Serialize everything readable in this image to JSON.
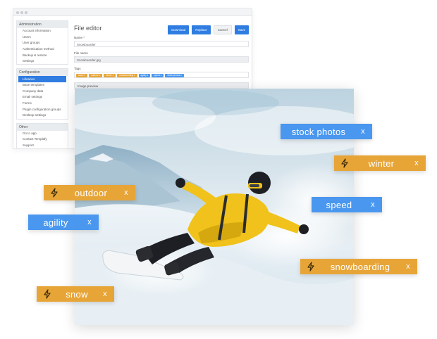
{
  "sidebar": {
    "groups": [
      {
        "title": "Administration",
        "items": [
          "Account information",
          "Users",
          "User groups",
          "Authentication method",
          "Backup & restore",
          "Settings"
        ]
      },
      {
        "title": "Configuration",
        "items": [
          "Libraries",
          "Base templates",
          "Company data",
          "Email settings",
          "Forms",
          "Plugin configuration groups",
          "Desktop settings"
        ],
        "active_index": 0
      },
      {
        "title": "Other",
        "items": [
          "Go to app",
          "Contact Templafy",
          "Support"
        ]
      }
    ]
  },
  "editor": {
    "title": "File editor",
    "buttons": {
      "download": "Download",
      "replace": "Replace",
      "cancel": "Cancel",
      "save": "Save"
    },
    "name_label": "Name *",
    "name_value": "Snowboarder",
    "filename_label": "File name",
    "filename_value": "Snowboarder.jpg",
    "tags_label": "Tags",
    "mini_tags": [
      {
        "label": "snow x",
        "color": "orange"
      },
      {
        "label": "outdoor x",
        "color": "orange"
      },
      {
        "label": "winter x",
        "color": "orange"
      },
      {
        "label": "snowboarding x",
        "color": "orange"
      },
      {
        "label": "agility x",
        "color": "blue"
      },
      {
        "label": "speed x",
        "color": "blue"
      },
      {
        "label": "stock photos x",
        "color": "blue"
      }
    ],
    "preview_label": "Image preview"
  },
  "overlay_tags": {
    "stock_photos": {
      "label": "stock photos",
      "remove": "x",
      "color": "#4a97ef"
    },
    "winter": {
      "label": "winter",
      "remove": "x",
      "color": "#e7a538",
      "icon": "lightning-icon"
    },
    "outdoor": {
      "label": "outdoor",
      "remove": "x",
      "color": "#e7a538",
      "icon": "lightning-icon"
    },
    "speed": {
      "label": "speed",
      "remove": "x",
      "color": "#4a97ef"
    },
    "agility": {
      "label": "agility",
      "remove": "x",
      "color": "#4a97ef"
    },
    "snowboarding": {
      "label": "snowboarding",
      "remove": "x",
      "color": "#e7a538",
      "icon": "lightning-icon"
    },
    "snow": {
      "label": "snow",
      "remove": "x",
      "color": "#e7a538",
      "icon": "lightning-icon"
    }
  },
  "colors": {
    "accent_blue": "#2f7de1",
    "tag_blue": "#4a97ef",
    "tag_orange": "#e7a538"
  }
}
